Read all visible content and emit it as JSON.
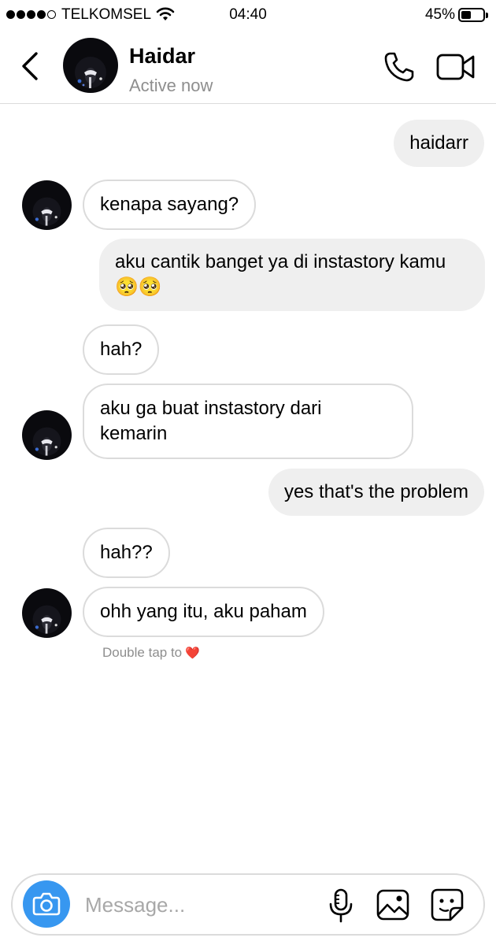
{
  "status_bar": {
    "carrier": "TELKOMSEL",
    "time": "04:40",
    "battery_percent": "45%",
    "battery_level": 0.45,
    "signal_bars": 4
  },
  "header": {
    "contact_name": "Haidar",
    "contact_status": "Active now"
  },
  "messages": [
    {
      "sender": "me",
      "text": "haidarr"
    },
    {
      "sender": "them",
      "text": "kenapa sayang?"
    },
    {
      "sender": "me",
      "text": "aku cantik banget ya di instastory kamu🥺🥺"
    },
    {
      "sender": "them",
      "text": "hah?"
    },
    {
      "sender": "them",
      "text": "aku ga buat instastory dari kemarin"
    },
    {
      "sender": "me",
      "text": "yes that's the problem"
    },
    {
      "sender": "them",
      "text": "hah??"
    },
    {
      "sender": "them",
      "text": "ohh yang itu, aku paham"
    }
  ],
  "hint": {
    "text": "Double tap to",
    "emoji": "❤️"
  },
  "composer": {
    "placeholder": "Message..."
  },
  "colors": {
    "accent": "#3797f0",
    "outgoing_bubble": "#efefef",
    "incoming_border": "#dbdbdb",
    "muted_text": "#8e8e8e"
  },
  "icons": [
    "back-icon",
    "phone-icon",
    "video-camera-icon",
    "camera-icon",
    "microphone-icon",
    "gallery-icon",
    "sticker-icon"
  ]
}
